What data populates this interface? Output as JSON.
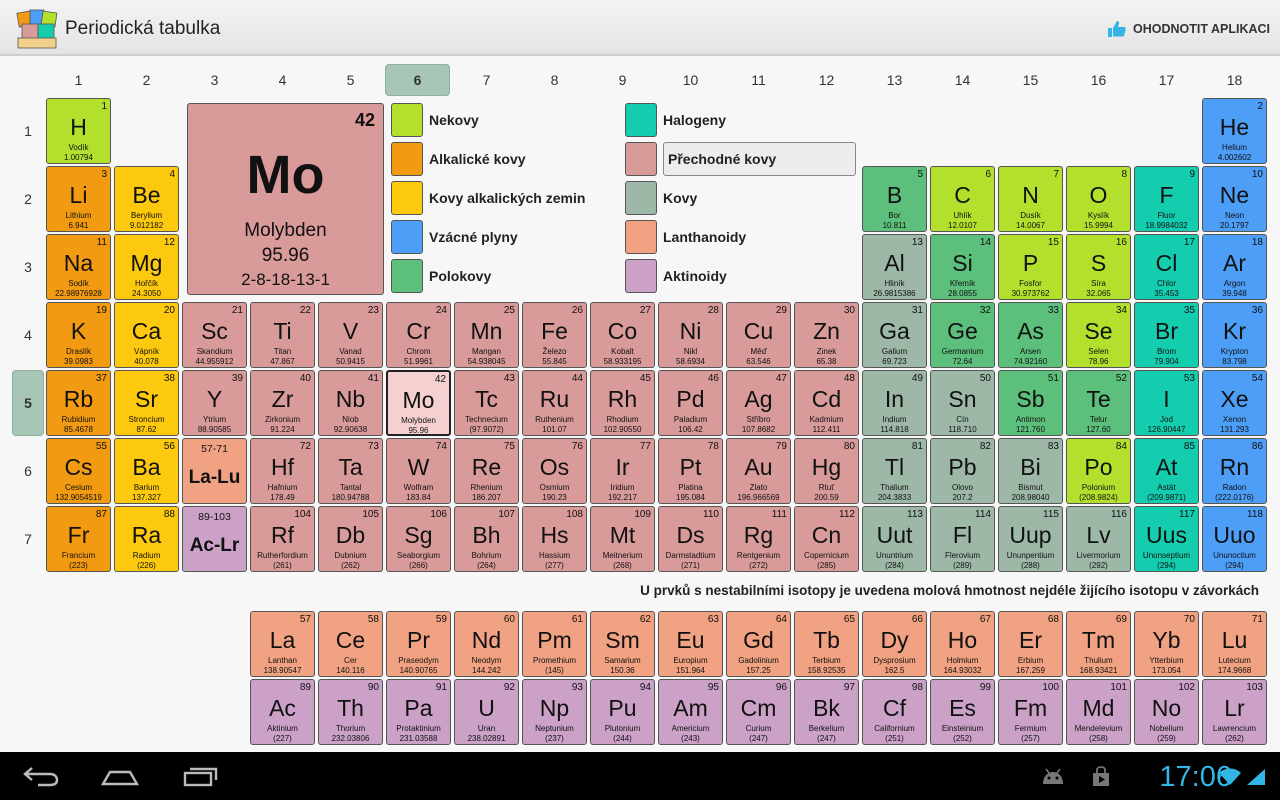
{
  "app": {
    "title": "Periodická tabulka",
    "rate_label": "OHODNOTIT APLIKACI"
  },
  "columns": [
    "1",
    "2",
    "3",
    "4",
    "5",
    "6",
    "7",
    "8",
    "9",
    "10",
    "11",
    "12",
    "13",
    "14",
    "15",
    "16",
    "17",
    "18"
  ],
  "selected_column": "6",
  "rows": [
    "1",
    "2",
    "3",
    "4",
    "5",
    "6",
    "7"
  ],
  "selected_row": "5",
  "colors": {
    "nonmetal": "#b3e02d",
    "alkali": "#f29b12",
    "alkaline": "#fdc90e",
    "noble": "#4d9ef7",
    "metalloid": "#5dbf7c",
    "halogen": "#14cdae",
    "transition": "#d99a9a",
    "metal": "#9db8a7",
    "lanthanide": "#f0a282",
    "actinide": "#cba1c7"
  },
  "legend": [
    {
      "label": "Nekovy",
      "cat": "nonmetal"
    },
    {
      "label": "Alkalické kovy",
      "cat": "alkali"
    },
    {
      "label": "Kovy alkalických zemin",
      "cat": "alkaline"
    },
    {
      "label": "Vzácné plyny",
      "cat": "noble"
    },
    {
      "label": "Polokovy",
      "cat": "metalloid"
    },
    {
      "label": "Halogeny",
      "cat": "halogen"
    },
    {
      "label": "Přechodné kovy",
      "cat": "transition"
    },
    {
      "label": "Kovy",
      "cat": "metal"
    },
    {
      "label": "Lanthanoidy",
      "cat": "lanthanide"
    },
    {
      "label": "Aktinoidy",
      "cat": "actinide"
    }
  ],
  "selected_legend": "Přechodné kovy",
  "selected": {
    "number": "42",
    "symbol": "Mo",
    "name": "Molybden",
    "mass": "95.96",
    "config": "2-8-18-13-1"
  },
  "note": "U prvků s nestabilními isotopy je uvedena molová hmotnost nejdéle žijícího isotopu v závorkách",
  "elements": [
    {
      "n": "1",
      "s": "H",
      "name": "Vodík",
      "m": "1.00794",
      "c": "nonmetal",
      "col": 1,
      "row": 1
    },
    {
      "n": "2",
      "s": "He",
      "name": "Helium",
      "m": "4.002602",
      "c": "noble",
      "col": 18,
      "row": 1
    },
    {
      "n": "3",
      "s": "Li",
      "name": "Lithium",
      "m": "6.941",
      "c": "alkali",
      "col": 1,
      "row": 2
    },
    {
      "n": "4",
      "s": "Be",
      "name": "Berylium",
      "m": "9.012182",
      "c": "alkaline",
      "col": 2,
      "row": 2
    },
    {
      "n": "5",
      "s": "B",
      "name": "Bor",
      "m": "10.811",
      "c": "metalloid",
      "col": 13,
      "row": 2
    },
    {
      "n": "6",
      "s": "C",
      "name": "Uhlík",
      "m": "12.0107",
      "c": "nonmetal",
      "col": 14,
      "row": 2
    },
    {
      "n": "7",
      "s": "N",
      "name": "Dusík",
      "m": "14.0067",
      "c": "nonmetal",
      "col": 15,
      "row": 2
    },
    {
      "n": "8",
      "s": "O",
      "name": "Kyslík",
      "m": "15.9994",
      "c": "nonmetal",
      "col": 16,
      "row": 2
    },
    {
      "n": "9",
      "s": "F",
      "name": "Fluor",
      "m": "18.9984032",
      "c": "halogen",
      "col": 17,
      "row": 2
    },
    {
      "n": "10",
      "s": "Ne",
      "name": "Neon",
      "m": "20.1797",
      "c": "noble",
      "col": 18,
      "row": 2
    },
    {
      "n": "11",
      "s": "Na",
      "name": "Sodík",
      "m": "22.98976928",
      "c": "alkali",
      "col": 1,
      "row": 3
    },
    {
      "n": "12",
      "s": "Mg",
      "name": "Hořčík",
      "m": "24.3050",
      "c": "alkaline",
      "col": 2,
      "row": 3
    },
    {
      "n": "13",
      "s": "Al",
      "name": "Hliník",
      "m": "26.9815386",
      "c": "metal",
      "col": 13,
      "row": 3
    },
    {
      "n": "14",
      "s": "Si",
      "name": "Křemík",
      "m": "28.0855",
      "c": "metalloid",
      "col": 14,
      "row": 3
    },
    {
      "n": "15",
      "s": "P",
      "name": "Fosfor",
      "m": "30.973762",
      "c": "nonmetal",
      "col": 15,
      "row": 3
    },
    {
      "n": "16",
      "s": "S",
      "name": "Síra",
      "m": "32.065",
      "c": "nonmetal",
      "col": 16,
      "row": 3
    },
    {
      "n": "17",
      "s": "Cl",
      "name": "Chlor",
      "m": "35.453",
      "c": "halogen",
      "col": 17,
      "row": 3
    },
    {
      "n": "18",
      "s": "Ar",
      "name": "Argon",
      "m": "39.948",
      "c": "noble",
      "col": 18,
      "row": 3
    },
    {
      "n": "19",
      "s": "K",
      "name": "Draslík",
      "m": "39.0983",
      "c": "alkali",
      "col": 1,
      "row": 4
    },
    {
      "n": "20",
      "s": "Ca",
      "name": "Vápník",
      "m": "40.078",
      "c": "alkaline",
      "col": 2,
      "row": 4
    },
    {
      "n": "21",
      "s": "Sc",
      "name": "Skandium",
      "m": "44.955912",
      "c": "transition",
      "col": 3,
      "row": 4
    },
    {
      "n": "22",
      "s": "Ti",
      "name": "Titan",
      "m": "47.867",
      "c": "transition",
      "col": 4,
      "row": 4
    },
    {
      "n": "23",
      "s": "V",
      "name": "Vanad",
      "m": "50.9415",
      "c": "transition",
      "col": 5,
      "row": 4
    },
    {
      "n": "24",
      "s": "Cr",
      "name": "Chrom",
      "m": "51.9961",
      "c": "transition",
      "col": 6,
      "row": 4
    },
    {
      "n": "25",
      "s": "Mn",
      "name": "Mangan",
      "m": "54.938045",
      "c": "transition",
      "col": 7,
      "row": 4
    },
    {
      "n": "26",
      "s": "Fe",
      "name": "Železo",
      "m": "55.845",
      "c": "transition",
      "col": 8,
      "row": 4
    },
    {
      "n": "27",
      "s": "Co",
      "name": "Kobalt",
      "m": "58.933195",
      "c": "transition",
      "col": 9,
      "row": 4
    },
    {
      "n": "28",
      "s": "Ni",
      "name": "Nikl",
      "m": "58.6934",
      "c": "transition",
      "col": 10,
      "row": 4
    },
    {
      "n": "29",
      "s": "Cu",
      "name": "Měď",
      "m": "63.546",
      "c": "transition",
      "col": 11,
      "row": 4
    },
    {
      "n": "30",
      "s": "Zn",
      "name": "Zinek",
      "m": "65.38",
      "c": "transition",
      "col": 12,
      "row": 4
    },
    {
      "n": "31",
      "s": "Ga",
      "name": "Galium",
      "m": "69.723",
      "c": "metal",
      "col": 13,
      "row": 4
    },
    {
      "n": "32",
      "s": "Ge",
      "name": "Germanium",
      "m": "72.64",
      "c": "metalloid",
      "col": 14,
      "row": 4
    },
    {
      "n": "33",
      "s": "As",
      "name": "Arsen",
      "m": "74.92160",
      "c": "metalloid",
      "col": 15,
      "row": 4
    },
    {
      "n": "34",
      "s": "Se",
      "name": "Selen",
      "m": "78.96",
      "c": "nonmetal",
      "col": 16,
      "row": 4
    },
    {
      "n": "35",
      "s": "Br",
      "name": "Brom",
      "m": "79.904",
      "c": "halogen",
      "col": 17,
      "row": 4
    },
    {
      "n": "36",
      "s": "Kr",
      "name": "Krypton",
      "m": "83.798",
      "c": "noble",
      "col": 18,
      "row": 4
    },
    {
      "n": "37",
      "s": "Rb",
      "name": "Rubidium",
      "m": "85.4678",
      "c": "alkali",
      "col": 1,
      "row": 5
    },
    {
      "n": "38",
      "s": "Sr",
      "name": "Stroncium",
      "m": "87.62",
      "c": "alkaline",
      "col": 2,
      "row": 5
    },
    {
      "n": "39",
      "s": "Y",
      "name": "Ytrium",
      "m": "88.90585",
      "c": "transition",
      "col": 3,
      "row": 5
    },
    {
      "n": "40",
      "s": "Zr",
      "name": "Zirkonium",
      "m": "91.224",
      "c": "transition",
      "col": 4,
      "row": 5
    },
    {
      "n": "41",
      "s": "Nb",
      "name": "Niob",
      "m": "92.90638",
      "c": "transition",
      "col": 5,
      "row": 5
    },
    {
      "n": "42",
      "s": "Mo",
      "name": "Molybden",
      "m": "95.96",
      "c": "selected",
      "col": 6,
      "row": 5
    },
    {
      "n": "43",
      "s": "Tc",
      "name": "Technecium",
      "m": "(97.9072)",
      "c": "transition",
      "col": 7,
      "row": 5
    },
    {
      "n": "44",
      "s": "Ru",
      "name": "Ruthenium",
      "m": "101.07",
      "c": "transition",
      "col": 8,
      "row": 5
    },
    {
      "n": "45",
      "s": "Rh",
      "name": "Rhodium",
      "m": "102.90550",
      "c": "transition",
      "col": 9,
      "row": 5
    },
    {
      "n": "46",
      "s": "Pd",
      "name": "Paladium",
      "m": "106.42",
      "c": "transition",
      "col": 10,
      "row": 5
    },
    {
      "n": "47",
      "s": "Ag",
      "name": "Stříbro",
      "m": "107.8682",
      "c": "transition",
      "col": 11,
      "row": 5
    },
    {
      "n": "48",
      "s": "Cd",
      "name": "Kadmium",
      "m": "112.411",
      "c": "transition",
      "col": 12,
      "row": 5
    },
    {
      "n": "49",
      "s": "In",
      "name": "Indium",
      "m": "114.818",
      "c": "metal",
      "col": 13,
      "row": 5
    },
    {
      "n": "50",
      "s": "Sn",
      "name": "Cín",
      "m": "118.710",
      "c": "metal",
      "col": 14,
      "row": 5
    },
    {
      "n": "51",
      "s": "Sb",
      "name": "Antimon",
      "m": "121.760",
      "c": "metalloid",
      "col": 15,
      "row": 5
    },
    {
      "n": "52",
      "s": "Te",
      "name": "Telur",
      "m": "127.60",
      "c": "metalloid",
      "col": 16,
      "row": 5
    },
    {
      "n": "53",
      "s": "I",
      "name": "Jod",
      "m": "126.90447",
      "c": "halogen",
      "col": 17,
      "row": 5
    },
    {
      "n": "54",
      "s": "Xe",
      "name": "Xenon",
      "m": "131.293",
      "c": "noble",
      "col": 18,
      "row": 5
    },
    {
      "n": "55",
      "s": "Cs",
      "name": "Cesium",
      "m": "132.9054519",
      "c": "alkali",
      "col": 1,
      "row": 6
    },
    {
      "n": "56",
      "s": "Ba",
      "name": "Barium",
      "m": "137.327",
      "c": "alkaline",
      "col": 2,
      "row": 6
    },
    {
      "n": "57-71",
      "s": "La-Lu",
      "name": "",
      "m": "",
      "c": "lanthanide",
      "col": 3,
      "row": 6,
      "ph": true
    },
    {
      "n": "72",
      "s": "Hf",
      "name": "Hafnium",
      "m": "178.49",
      "c": "transition",
      "col": 4,
      "row": 6
    },
    {
      "n": "73",
      "s": "Ta",
      "name": "Tantal",
      "m": "180.94788",
      "c": "transition",
      "col": 5,
      "row": 6
    },
    {
      "n": "74",
      "s": "W",
      "name": "Wolfram",
      "m": "183.84",
      "c": "transition",
      "col": 6,
      "row": 6
    },
    {
      "n": "75",
      "s": "Re",
      "name": "Rhenium",
      "m": "186.207",
      "c": "transition",
      "col": 7,
      "row": 6
    },
    {
      "n": "76",
      "s": "Os",
      "name": "Osmium",
      "m": "190.23",
      "c": "transition",
      "col": 8,
      "row": 6
    },
    {
      "n": "77",
      "s": "Ir",
      "name": "Iridium",
      "m": "192.217",
      "c": "transition",
      "col": 9,
      "row": 6
    },
    {
      "n": "78",
      "s": "Pt",
      "name": "Platina",
      "m": "195.084",
      "c": "transition",
      "col": 10,
      "row": 6
    },
    {
      "n": "79",
      "s": "Au",
      "name": "Zlato",
      "m": "196.966569",
      "c": "transition",
      "col": 11,
      "row": 6
    },
    {
      "n": "80",
      "s": "Hg",
      "name": "Rtuť",
      "m": "200.59",
      "c": "transition",
      "col": 12,
      "row": 6
    },
    {
      "n": "81",
      "s": "Tl",
      "name": "Thalium",
      "m": "204.3833",
      "c": "metal",
      "col": 13,
      "row": 6
    },
    {
      "n": "82",
      "s": "Pb",
      "name": "Olovo",
      "m": "207.2",
      "c": "metal",
      "col": 14,
      "row": 6
    },
    {
      "n": "83",
      "s": "Bi",
      "name": "Bismut",
      "m": "208.98040",
      "c": "metal",
      "col": 15,
      "row": 6
    },
    {
      "n": "84",
      "s": "Po",
      "name": "Polonium",
      "m": "(208.9824)",
      "c": "nonmetal",
      "col": 16,
      "row": 6
    },
    {
      "n": "85",
      "s": "At",
      "name": "Astát",
      "m": "(209.9871)",
      "c": "halogen",
      "col": 17,
      "row": 6
    },
    {
      "n": "86",
      "s": "Rn",
      "name": "Radon",
      "m": "(222.0176)",
      "c": "noble",
      "col": 18,
      "row": 6
    },
    {
      "n": "87",
      "s": "Fr",
      "name": "Francium",
      "m": "(223)",
      "c": "alkali",
      "col": 1,
      "row": 7
    },
    {
      "n": "88",
      "s": "Ra",
      "name": "Radium",
      "m": "(226)",
      "c": "alkaline",
      "col": 2,
      "row": 7
    },
    {
      "n": "89-103",
      "s": "Ac-Lr",
      "name": "",
      "m": "",
      "c": "actinide",
      "col": 3,
      "row": 7,
      "ph": true
    },
    {
      "n": "104",
      "s": "Rf",
      "name": "Rutherfordium",
      "m": "(261)",
      "c": "transition",
      "col": 4,
      "row": 7
    },
    {
      "n": "105",
      "s": "Db",
      "name": "Dubnium",
      "m": "(262)",
      "c": "transition",
      "col": 5,
      "row": 7
    },
    {
      "n": "106",
      "s": "Sg",
      "name": "Seaborgium",
      "m": "(266)",
      "c": "transition",
      "col": 6,
      "row": 7
    },
    {
      "n": "107",
      "s": "Bh",
      "name": "Bohrium",
      "m": "(264)",
      "c": "transition",
      "col": 7,
      "row": 7
    },
    {
      "n": "108",
      "s": "Hs",
      "name": "Hassium",
      "m": "(277)",
      "c": "transition",
      "col": 8,
      "row": 7
    },
    {
      "n": "109",
      "s": "Mt",
      "name": "Meitnerium",
      "m": "(268)",
      "c": "transition",
      "col": 9,
      "row": 7
    },
    {
      "n": "110",
      "s": "Ds",
      "name": "Darmstadtium",
      "m": "(271)",
      "c": "transition",
      "col": 10,
      "row": 7
    },
    {
      "n": "111",
      "s": "Rg",
      "name": "Rentgenium",
      "m": "(272)",
      "c": "transition",
      "col": 11,
      "row": 7
    },
    {
      "n": "112",
      "s": "Cn",
      "name": "Copernicium",
      "m": "(285)",
      "c": "transition",
      "col": 12,
      "row": 7
    },
    {
      "n": "113",
      "s": "Uut",
      "name": "Ununtrium",
      "m": "(284)",
      "c": "metal",
      "col": 13,
      "row": 7
    },
    {
      "n": "114",
      "s": "Fl",
      "name": "Flerovium",
      "m": "(289)",
      "c": "metal",
      "col": 14,
      "row": 7
    },
    {
      "n": "115",
      "s": "Uup",
      "name": "Ununpentium",
      "m": "(288)",
      "c": "metal",
      "col": 15,
      "row": 7
    },
    {
      "n": "116",
      "s": "Lv",
      "name": "Livermorium",
      "m": "(292)",
      "c": "metal",
      "col": 16,
      "row": 7
    },
    {
      "n": "117",
      "s": "Uus",
      "name": "Ununseptium",
      "m": "(294)",
      "c": "halogen",
      "col": 17,
      "row": 7
    },
    {
      "n": "118",
      "s": "Uuo",
      "name": "Ununoctium",
      "m": "(294)",
      "c": "noble",
      "col": 18,
      "row": 7
    },
    {
      "n": "57",
      "s": "La",
      "name": "Lanthan",
      "m": "138.90547",
      "c": "lanthanide",
      "col": 4,
      "row": 8
    },
    {
      "n": "58",
      "s": "Ce",
      "name": "Cer",
      "m": "140.116",
      "c": "lanthanide",
      "col": 5,
      "row": 8
    },
    {
      "n": "59",
      "s": "Pr",
      "name": "Praseodym",
      "m": "140.90765",
      "c": "lanthanide",
      "col": 6,
      "row": 8
    },
    {
      "n": "60",
      "s": "Nd",
      "name": "Neodym",
      "m": "144.242",
      "c": "lanthanide",
      "col": 7,
      "row": 8
    },
    {
      "n": "61",
      "s": "Pm",
      "name": "Promethium",
      "m": "(145)",
      "c": "lanthanide",
      "col": 8,
      "row": 8
    },
    {
      "n": "62",
      "s": "Sm",
      "name": "Samarium",
      "m": "150.36",
      "c": "lanthanide",
      "col": 9,
      "row": 8
    },
    {
      "n": "63",
      "s": "Eu",
      "name": "Europium",
      "m": "151.964",
      "c": "lanthanide",
      "col": 10,
      "row": 8
    },
    {
      "n": "64",
      "s": "Gd",
      "name": "Gadolinium",
      "m": "157.25",
      "c": "lanthanide",
      "col": 11,
      "row": 8
    },
    {
      "n": "65",
      "s": "Tb",
      "name": "Terbium",
      "m": "158.92535",
      "c": "lanthanide",
      "col": 12,
      "row": 8
    },
    {
      "n": "66",
      "s": "Dy",
      "name": "Dysprosium",
      "m": "162.5",
      "c": "lanthanide",
      "col": 13,
      "row": 8
    },
    {
      "n": "67",
      "s": "Ho",
      "name": "Holmium",
      "m": "164.93032",
      "c": "lanthanide",
      "col": 14,
      "row": 8
    },
    {
      "n": "68",
      "s": "Er",
      "name": "Erbium",
      "m": "167.259",
      "c": "lanthanide",
      "col": 15,
      "row": 8
    },
    {
      "n": "69",
      "s": "Tm",
      "name": "Thulium",
      "m": "168.93421",
      "c": "lanthanide",
      "col": 16,
      "row": 8
    },
    {
      "n": "70",
      "s": "Yb",
      "name": "Ytterbium",
      "m": "173.054",
      "c": "lanthanide",
      "col": 17,
      "row": 8
    },
    {
      "n": "71",
      "s": "Lu",
      "name": "Lutecium",
      "m": "174.9668",
      "c": "lanthanide",
      "col": 18,
      "row": 8
    },
    {
      "n": "89",
      "s": "Ac",
      "name": "Aktinium",
      "m": "(227)",
      "c": "actinide",
      "col": 4,
      "row": 9
    },
    {
      "n": "90",
      "s": "Th",
      "name": "Thorium",
      "m": "232.03806",
      "c": "actinide",
      "col": 5,
      "row": 9
    },
    {
      "n": "91",
      "s": "Pa",
      "name": "Protaktinium",
      "m": "231.03588",
      "c": "actinide",
      "col": 6,
      "row": 9
    },
    {
      "n": "92",
      "s": "U",
      "name": "Uran",
      "m": "238.02891",
      "c": "actinide",
      "col": 7,
      "row": 9
    },
    {
      "n": "93",
      "s": "Np",
      "name": "Neptunium",
      "m": "(237)",
      "c": "actinide",
      "col": 8,
      "row": 9
    },
    {
      "n": "94",
      "s": "Pu",
      "name": "Plutonium",
      "m": "(244)",
      "c": "actinide",
      "col": 9,
      "row": 9
    },
    {
      "n": "95",
      "s": "Am",
      "name": "Americium",
      "m": "(243)",
      "c": "actinide",
      "col": 10,
      "row": 9
    },
    {
      "n": "96",
      "s": "Cm",
      "name": "Curium",
      "m": "(247)",
      "c": "actinide",
      "col": 11,
      "row": 9
    },
    {
      "n": "97",
      "s": "Bk",
      "name": "Berkelium",
      "m": "(247)",
      "c": "actinide",
      "col": 12,
      "row": 9
    },
    {
      "n": "98",
      "s": "Cf",
      "name": "Californium",
      "m": "(251)",
      "c": "actinide",
      "col": 13,
      "row": 9
    },
    {
      "n": "99",
      "s": "Es",
      "name": "Einsteinium",
      "m": "(252)",
      "c": "actinide",
      "col": 14,
      "row": 9
    },
    {
      "n": "100",
      "s": "Fm",
      "name": "Fermium",
      "m": "(257)",
      "c": "actinide",
      "col": 15,
      "row": 9
    },
    {
      "n": "101",
      "s": "Md",
      "name": "Mendelevium",
      "m": "(258)",
      "c": "actinide",
      "col": 16,
      "row": 9
    },
    {
      "n": "102",
      "s": "No",
      "name": "Nobelium",
      "m": "(259)",
      "c": "actinide",
      "col": 17,
      "row": 9
    },
    {
      "n": "103",
      "s": "Lr",
      "name": "Lawrencium",
      "m": "(262)",
      "c": "actinide",
      "col": 18,
      "row": 9
    }
  ],
  "status": {
    "time": "17:06"
  },
  "icons": {
    "app_logo": "app-logo-icon",
    "rate": "thumbs-up-icon",
    "back": "back-icon",
    "home": "home-icon",
    "recents": "recents-icon",
    "android": "android-icon",
    "store": "store-icon",
    "wifi": "wifi-icon",
    "signal": "signal-icon"
  }
}
